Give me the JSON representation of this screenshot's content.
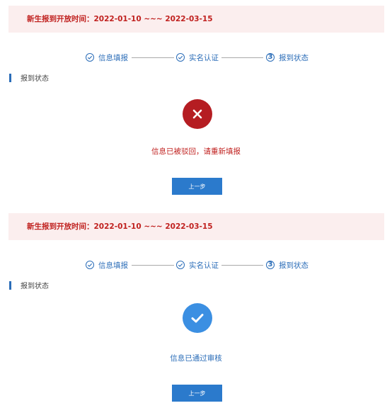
{
  "colors": {
    "banner_bg": "#fbeeee",
    "banner_text": "#c0211f",
    "primary_blue": "#2b6db8",
    "button_blue": "#2b7acc",
    "reject_red": "#b51d22",
    "approve_blue": "#3b8fe2"
  },
  "panels": [
    {
      "banner": {
        "text": "新生报到开放时间：2022-01-10 ~~~ 2022-03-15"
      },
      "steps": [
        {
          "label": "信息填报",
          "icon": "check-circle-icon"
        },
        {
          "label": "实名认证",
          "icon": "check-circle-icon"
        },
        {
          "label": "报到状态",
          "number": "3"
        }
      ],
      "section_title": "报到状态",
      "result": {
        "status": "rejected",
        "icon": "close-icon",
        "message": "信息已被驳回，请重新填报"
      },
      "button": {
        "label": "上一步"
      }
    },
    {
      "banner": {
        "text": "新生报到开放时间：2022-01-10 ~~~ 2022-03-15"
      },
      "steps": [
        {
          "label": "信息填报",
          "icon": "check-circle-icon"
        },
        {
          "label": "实名认证",
          "icon": "check-circle-icon"
        },
        {
          "label": "报到状态",
          "number": "3"
        }
      ],
      "section_title": "报到状态",
      "result": {
        "status": "approved",
        "icon": "check-icon",
        "message": "信息已通过审核"
      },
      "button": {
        "label": "上一步"
      }
    }
  ]
}
